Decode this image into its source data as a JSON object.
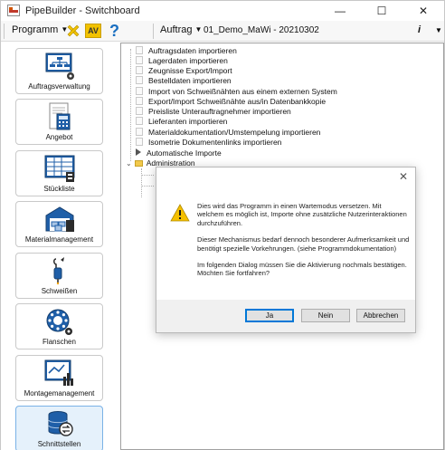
{
  "window": {
    "title": "PipeBuilder - Switchboard",
    "controls": {
      "minimize": "—",
      "maximize": "☐",
      "close": "✕"
    }
  },
  "toolbar": {
    "programm_label": "Programm",
    "av_label": "AV",
    "help_label": "?",
    "auftrag_label": "Auftrag",
    "auftrag_value": "01_Demo_MaWi - 20210302",
    "info_label": "i"
  },
  "sidebar": {
    "items": [
      {
        "label": "Auftragsverwaltung",
        "icon": "order-management-icon"
      },
      {
        "label": "Angebot",
        "icon": "calculator-icon"
      },
      {
        "label": "Stückliste",
        "icon": "bill-of-materials-icon"
      },
      {
        "label": "Materialmanagement",
        "icon": "warehouse-icon"
      },
      {
        "label": "Schweißen",
        "icon": "welding-icon"
      },
      {
        "label": "Flanschen",
        "icon": "flange-icon"
      },
      {
        "label": "Montagemanagement",
        "icon": "assembly-chart-icon"
      },
      {
        "label": "Schnittstellen",
        "icon": "interfaces-icon"
      }
    ],
    "active_index": 7
  },
  "tree": {
    "items": [
      "Auftragsdaten importieren",
      "Lagerdaten importieren",
      "Zeugnisse Export/Import",
      "Bestelldaten importieren",
      "Import von Schweißnähten aus einem externen System",
      "Export/Import Schweißnähte aus/in Datenbankkopie",
      "Preisliste Unterauftragnehmer importieren",
      "Lieferanten importieren",
      "Materialdokumentation/Umstempelung importieren",
      "Isometrie Dokumentenlinks importieren"
    ],
    "expandable": [
      {
        "label": "Automatische Importe",
        "state": "collapsed"
      },
      {
        "label": "Administration",
        "state": "expanded"
      }
    ]
  },
  "dialog": {
    "close": "✕",
    "paragraphs": [
      "Dies wird das Programm in einen Wartemodus versetzen. Mit welchem es möglich ist, Importe ohne zusätzliche Nutzerinteraktionen durchzuführen.",
      "Dieser Mechanismus bedarf dennoch besonderer Aufmerksamkeit und benötigt spezielle Vorkehrungen. (siehe Programmdokumentation)",
      "Im folgenden Dialog müssen Sie die Aktivierung nochmals bestätigen.\nMöchten Sie fortfahren?"
    ],
    "buttons": {
      "yes": "Ja",
      "no": "Nein",
      "cancel": "Abbrechen"
    }
  },
  "colors": {
    "accent": "#0078d7",
    "active_nav_bg": "#e5f1fb",
    "warning": "#f5c000",
    "help_blue": "#1a6fc1",
    "cross_yellow": "#f2c200"
  }
}
